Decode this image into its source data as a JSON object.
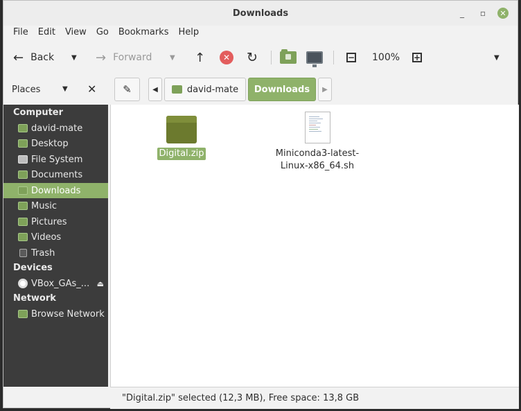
{
  "window": {
    "title": "Downloads"
  },
  "menu": [
    "File",
    "Edit",
    "View",
    "Go",
    "Bookmarks",
    "Help"
  ],
  "toolbar": {
    "back_label": "Back",
    "forward_label": "Forward",
    "zoom": "100%"
  },
  "places": {
    "label": "Places"
  },
  "location": {
    "crumbs": [
      "david-mate",
      "Downloads"
    ]
  },
  "sidebar": {
    "sections": {
      "computer": "Computer",
      "devices": "Devices",
      "network": "Network"
    },
    "computer_items": [
      "david-mate",
      "Desktop",
      "File System",
      "Documents",
      "Downloads",
      "Music",
      "Pictures",
      "Videos",
      "Trash"
    ],
    "device_items": [
      "VBox_GAs_..."
    ],
    "network_items": [
      "Browse Network"
    ],
    "selected": "Downloads"
  },
  "files": [
    {
      "name": "Digital.zip",
      "selected": true
    },
    {
      "name": "Miniconda3-latest-Linux-x86_64.sh",
      "selected": false
    }
  ],
  "status": "\"Digital.zip\" selected (12,3 MB), Free space: 13,8 GB",
  "colors": {
    "accent": "#8fb26a",
    "sidebar_bg": "#3c3c3c",
    "stop": "#e35d5d"
  }
}
